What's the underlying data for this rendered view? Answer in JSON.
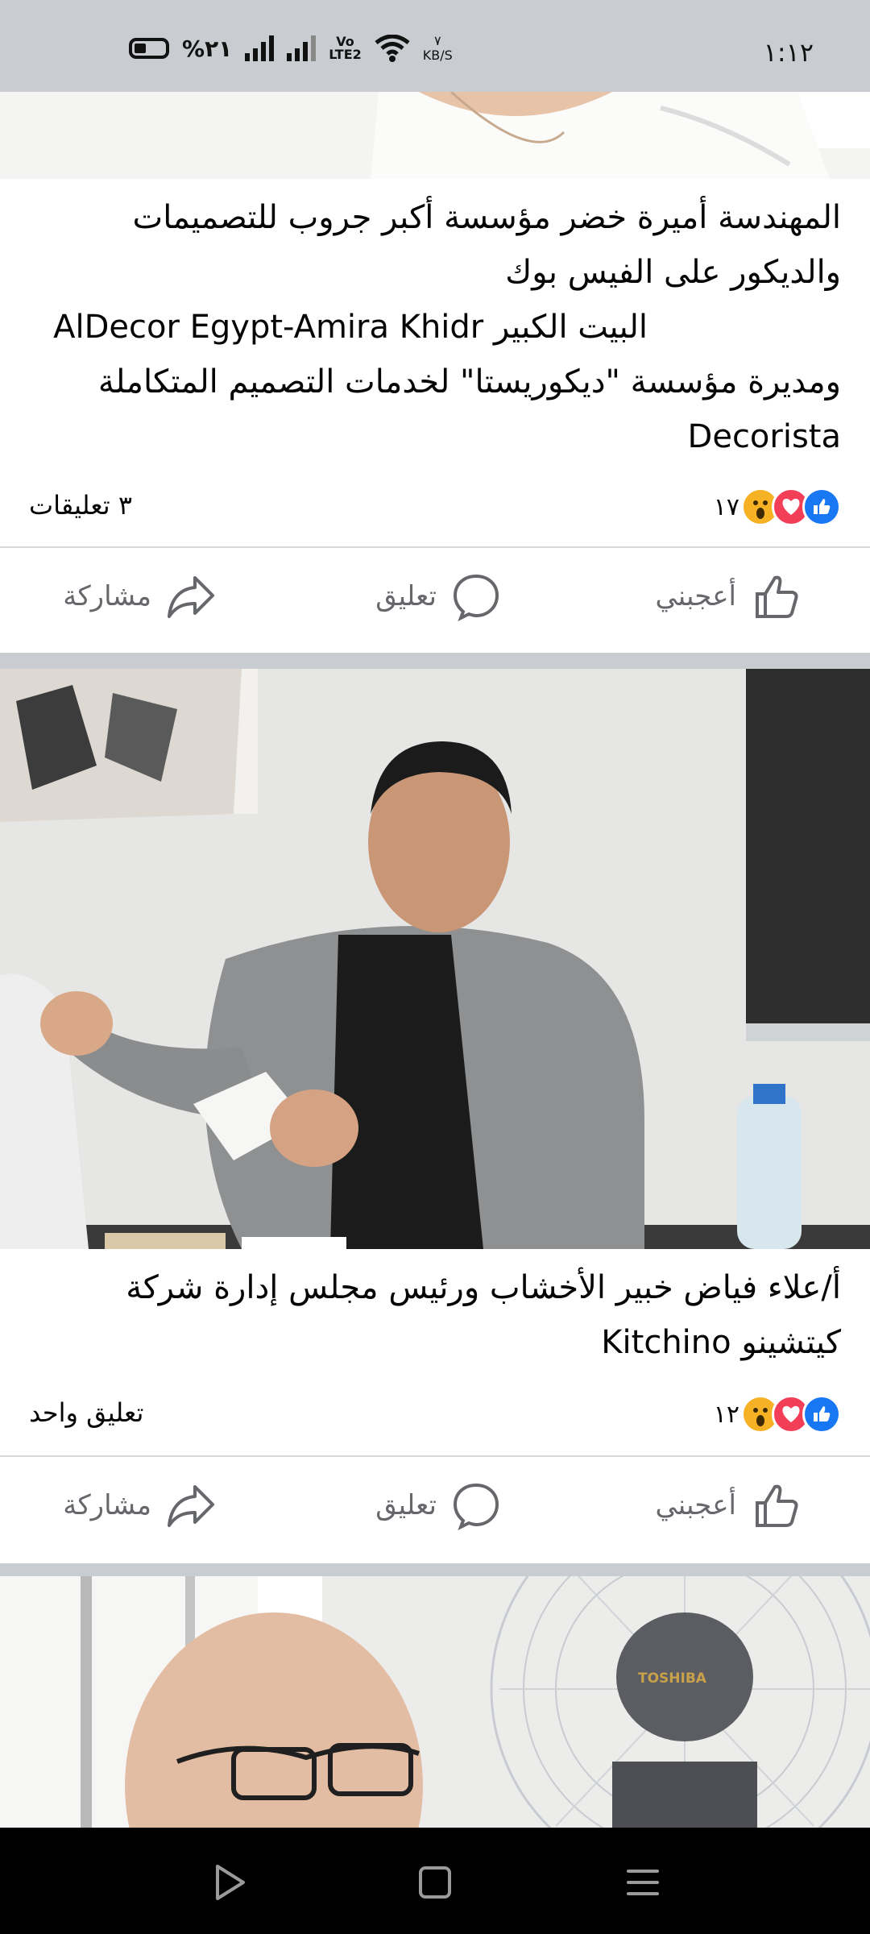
{
  "status_bar": {
    "time": "١:١٢",
    "battery": "%٢١",
    "volte": "Vo\nLTE2",
    "speed_value": "٧",
    "speed_unit": "KB/S"
  },
  "posts": [
    {
      "title_lines": [
        "المهندسة أميرة خضر مؤسسة أكبر جروب للتصميمات",
        "والديكور على الفيس بوك",
        "البيت الكبير AlDecor Egypt-Amira Khidr",
        "ومديرة مؤسسة \"ديكوريستا\" لخدمات التصميم المتكاملة",
        "Decorista"
      ],
      "reaction_count": "١٧",
      "comments": "٣ تعليقات"
    },
    {
      "title_lines": [
        "أ/علاء فياض خبير الأخشاب ورئيس مجلس إدارة شركة",
        "كيتشينو Kitchino"
      ],
      "reaction_count": "١٢",
      "comments": "تعليق واحد"
    }
  ],
  "actions": {
    "like": "أعجبني",
    "comment": "تعليق",
    "share": "مشاركة"
  },
  "photo3_text": "TOSHIBA",
  "colors": {
    "like_blue": "#1877f2",
    "love_red": "#f33e58",
    "wow_yellow": "#f7b125",
    "status_bg": "#c9ccd1"
  }
}
